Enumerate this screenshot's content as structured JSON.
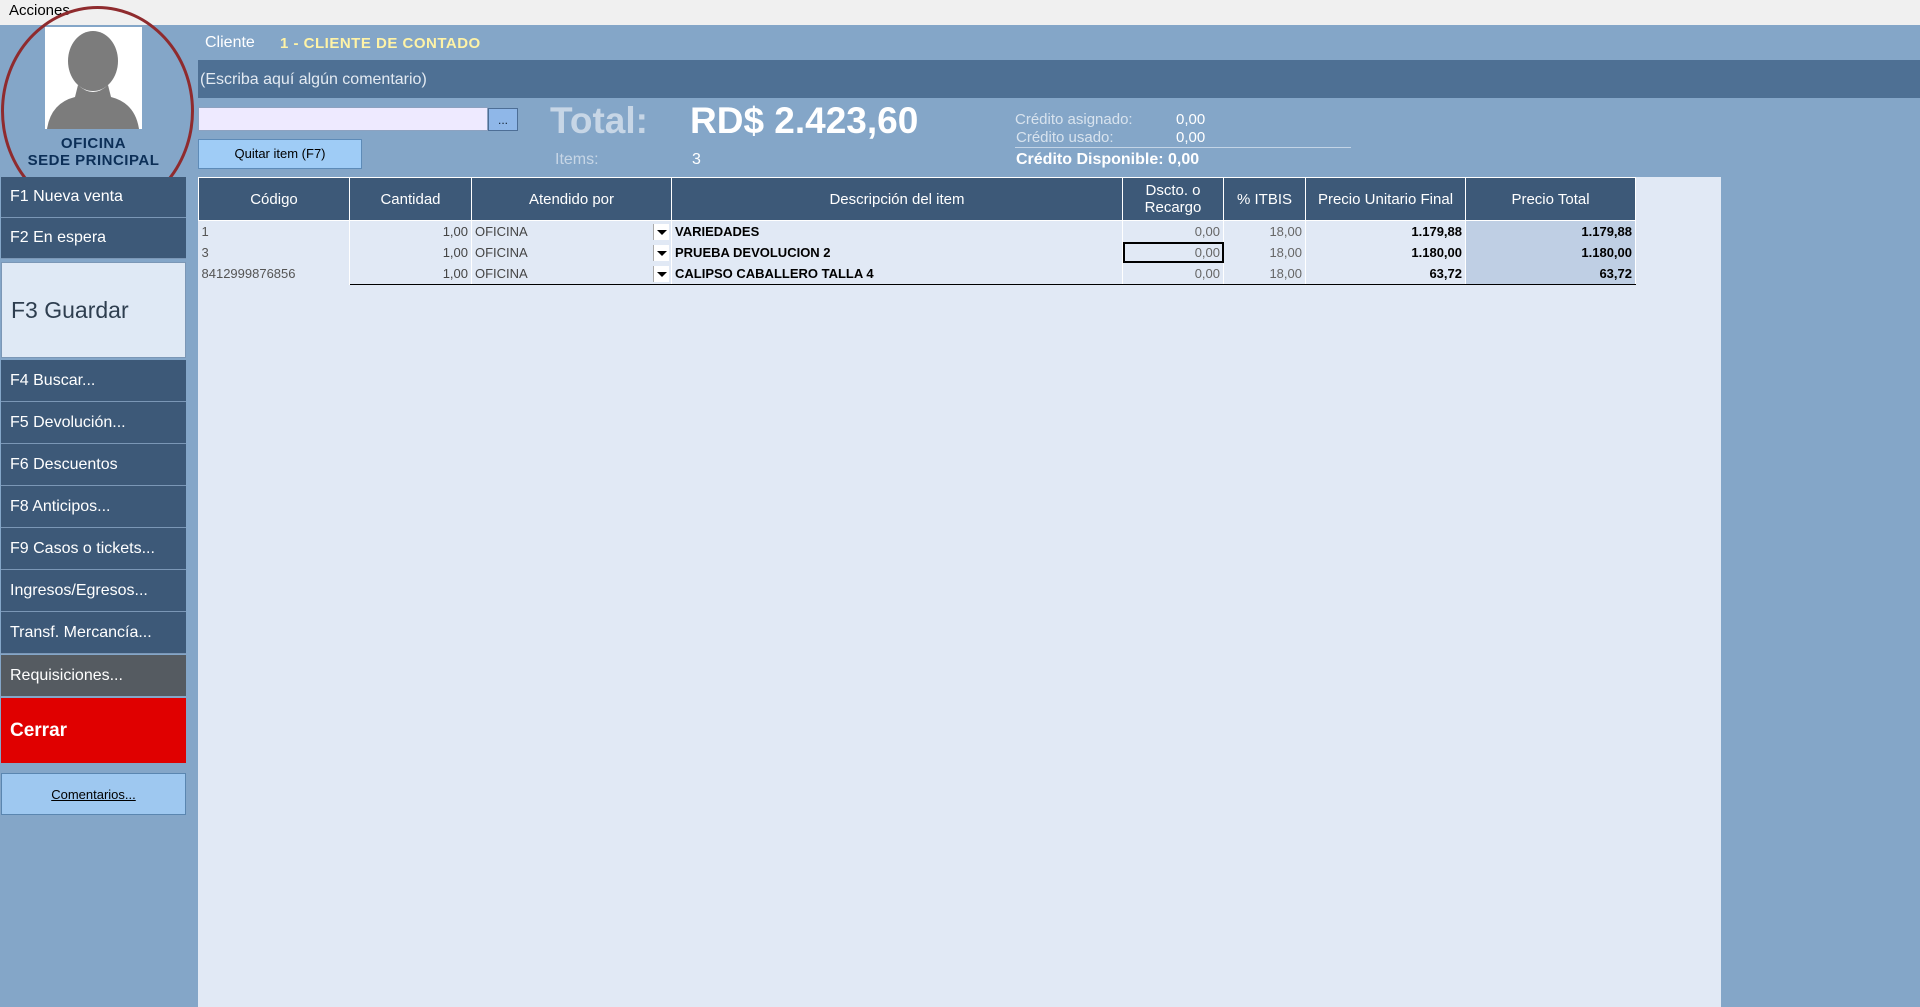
{
  "menu": {
    "acciones": "Acciones"
  },
  "profile": {
    "line1": "OFICINA",
    "line2": "SEDE PRINCIPAL"
  },
  "sidebar": {
    "f1": "F1 Nueva venta",
    "f2": "F2 En espera",
    "f3": "F3 Guardar",
    "f4": "F4 Buscar...",
    "f5": "F5 Devolución...",
    "f6": "F6 Descuentos",
    "f8": "F8 Anticipos...",
    "f9": "F9 Casos o tickets...",
    "ingresos": "Ingresos/Egresos...",
    "transf": "Transf. Mercancía...",
    "requisiciones": "Requisiciones...",
    "cerrar": "Cerrar",
    "comentarios": "Comentarios..."
  },
  "client": {
    "label": "Cliente",
    "value": "1 - CLIENTE DE CONTADO"
  },
  "comment_placeholder": "(Escriba aquí algún comentario)",
  "search": {
    "value": "",
    "dots": "..."
  },
  "remove_item": "Quitar item (F7)",
  "totals": {
    "label": "Total:",
    "value": "RD$ 2.423,60",
    "items_label": "Items:",
    "items_value": "3"
  },
  "credit": {
    "asignado_label": "Crédito asignado:",
    "asignado_value": "0,00",
    "usado_label": "Crédito usado:",
    "usado_value": "0,00",
    "disponible_label": "Crédito Disponible:",
    "disponible_value": "0,00"
  },
  "table": {
    "headers": {
      "codigo": "Código",
      "cantidad": "Cantidad",
      "atendido": "Atendido por",
      "descripcion": "Descripción del item",
      "dscto_1": "Dscto. o",
      "dscto_2": "Recargo",
      "itbis": "% ITBIS",
      "unitario": "Precio Unitario Final",
      "total": "Precio Total"
    },
    "rows": [
      {
        "codigo": "1",
        "cantidad": "1,00",
        "atendido": "OFICINA",
        "descripcion": "VARIEDADES",
        "dscto": "0,00",
        "itbis": "18,00",
        "unitario": "1.179,88",
        "total": "1.179,88"
      },
      {
        "codigo": "3",
        "cantidad": "1,00",
        "atendido": "OFICINA",
        "descripcion": "PRUEBA DEVOLUCION 2",
        "dscto": "0,00",
        "itbis": "18,00",
        "unitario": "1.180,00",
        "total": "1.180,00"
      },
      {
        "codigo": "8412999876856",
        "cantidad": "1,00",
        "atendido": "OFICINA",
        "descripcion": "CALIPSO CABALLERO TALLA 4",
        "dscto": "0,00",
        "itbis": "18,00",
        "unitario": "63,72",
        "total": "63,72"
      }
    ]
  },
  "colors": {
    "background": "#84a6c8",
    "sidebar_dark": "#3d5978",
    "close_red": "#e00000",
    "client_value": "#fff3a6",
    "grid_area": "#e1e9f5"
  }
}
